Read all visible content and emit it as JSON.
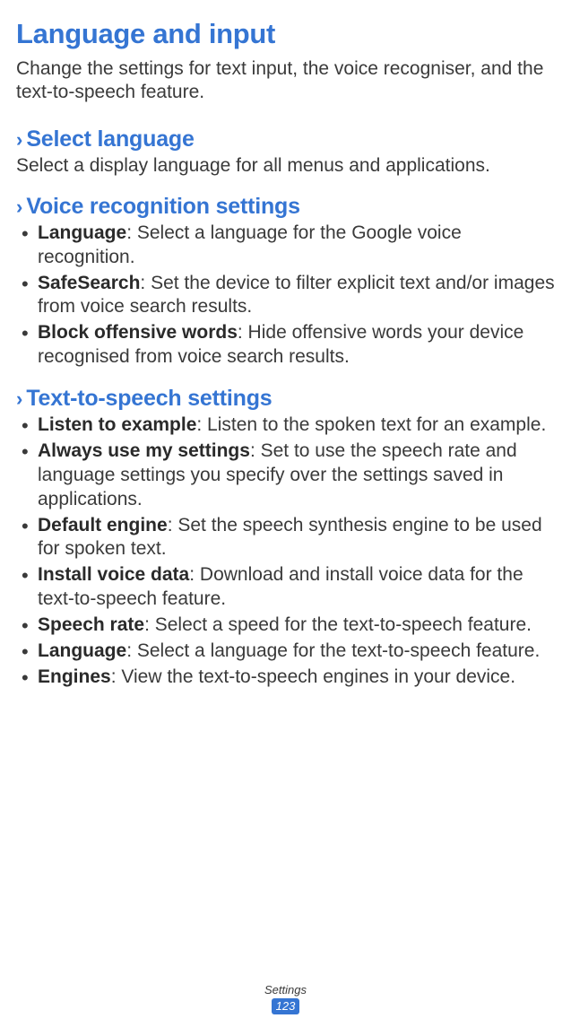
{
  "title": "Language and input",
  "intro": "Change the settings for text input, the voice recogniser, and the text-to-speech feature.",
  "sections": {
    "select_language": {
      "heading": "Select language",
      "desc": "Select a display language for all menus and applications."
    },
    "voice_recognition": {
      "heading": "Voice recognition settings",
      "items": [
        {
          "term": "Language",
          "desc": ": Select a language for the Google voice recognition."
        },
        {
          "term": "SafeSearch",
          "desc": ": Set the device to filter explicit text and/or images from voice search results."
        },
        {
          "term": "Block offensive words",
          "desc": ": Hide offensive words your device recognised from voice search results."
        }
      ]
    },
    "tts": {
      "heading": "Text-to-speech settings",
      "items": [
        {
          "term": "Listen to example",
          "desc": ": Listen to the spoken text for an example."
        },
        {
          "term": "Always use my settings",
          "desc": ": Set to use the speech rate and language settings you specify over the settings saved in applications."
        },
        {
          "term": "Default engine",
          "desc": ": Set the speech synthesis engine to be used for spoken text."
        },
        {
          "term": "Install voice data",
          "desc": ": Download and install voice data for the text-to-speech feature."
        },
        {
          "term": "Speech rate",
          "desc": ": Select a speed for the text-to-speech feature."
        },
        {
          "term": "Language",
          "desc": ": Select a language for the text-to-speech feature."
        },
        {
          "term": "Engines",
          "desc": ": View the text-to-speech engines in your device."
        }
      ]
    }
  },
  "chevron": "›",
  "footer": {
    "section": "Settings",
    "page": "123"
  }
}
